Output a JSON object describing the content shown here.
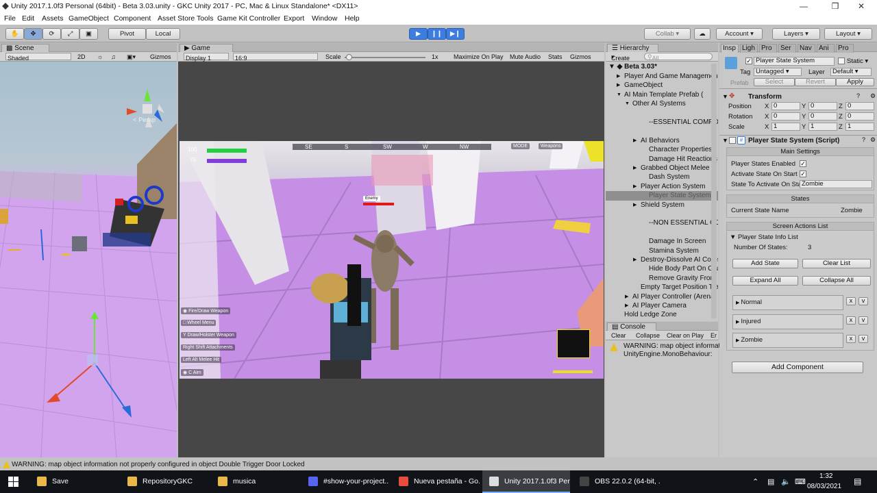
{
  "window": {
    "title": "Unity 2017.1.0f3 Personal (64bit) - Beta 3.03.unity - GKC Unity 2017 - PC, Mac & Linux Standalone* <DX11>"
  },
  "menu": [
    "File",
    "Edit",
    "Assets",
    "GameObject",
    "Component",
    "Asset Store Tools",
    "Game Kit Controller",
    "Export",
    "Window",
    "Help"
  ],
  "toolbar": {
    "pivot": "Pivot",
    "local": "Local",
    "collab": "Collab",
    "account": "Account",
    "layers": "Layers",
    "layout": "Layout"
  },
  "scene": {
    "tab": "Scene",
    "shading": "Shaded",
    "mode2d": "2D",
    "gizmos": "Gizmos",
    "persp": "< Persp",
    "search": "All"
  },
  "game": {
    "tab": "Game",
    "display": "Display 1",
    "aspect": "16:9",
    "scale_label": "Scale",
    "scale_value": "1x",
    "maximize": "Maximize On Play",
    "mute": "Mute Audio",
    "stats": "Stats",
    "gizmos": "Gizmos"
  },
  "hud": {
    "health": "100",
    "stamina": "75",
    "compass": [
      "SE",
      "S",
      "SW",
      "W",
      "NW"
    ],
    "mode": "MODE",
    "weapons": "Weapons",
    "enemy": "Enemy",
    "hints": [
      {
        "key": "",
        "label": "Fire/Draw Weapon"
      },
      {
        "key": "",
        "label": "Wheel Menu"
      },
      {
        "key": "Y",
        "label": "Draw/Holster Weapon"
      },
      {
        "key": "Right Shift",
        "label": "Attachments"
      },
      {
        "key": "Left Alt",
        "label": "Melee Hit"
      },
      {
        "key": "C",
        "label": "Aim"
      }
    ]
  },
  "hierarchy": {
    "tab": "Hierarchy",
    "create": "Create",
    "search": "All",
    "scene": "Beta 3.03*",
    "items": [
      {
        "label": "Player And Game Management",
        "indent": 1,
        "arrow": "▶"
      },
      {
        "label": "GameObject",
        "indent": 1,
        "arrow": "▶"
      },
      {
        "label": "AI Main Template Prefab (",
        "indent": 1,
        "arrow": "▼"
      },
      {
        "label": "Other AI Systems",
        "indent": 2,
        "arrow": "▼"
      },
      {
        "label": "",
        "indent": 3,
        "arrow": ""
      },
      {
        "label": "--ESSENTIAL COMPONENTS",
        "indent": 4,
        "arrow": ""
      },
      {
        "label": "",
        "indent": 3,
        "arrow": ""
      },
      {
        "label": "AI Behaviors",
        "indent": 3,
        "arrow": "▶"
      },
      {
        "label": "Character Properties",
        "indent": 4,
        "arrow": ""
      },
      {
        "label": "Damage Hit Reactions",
        "indent": 4,
        "arrow": ""
      },
      {
        "label": "Grabbed Object Melee",
        "indent": 3,
        "arrow": "▶"
      },
      {
        "label": "Dash System",
        "indent": 4,
        "arrow": ""
      },
      {
        "label": "Player Action System",
        "indent": 3,
        "arrow": "▶"
      },
      {
        "label": "Player State System",
        "indent": 4,
        "arrow": "",
        "selected": true
      },
      {
        "label": "Shield System",
        "indent": 3,
        "arrow": "▶"
      },
      {
        "label": "",
        "indent": 3,
        "arrow": ""
      },
      {
        "label": "--NON ESSENTIAL COMPONENTS",
        "indent": 4,
        "arrow": ""
      },
      {
        "label": "",
        "indent": 3,
        "arrow": ""
      },
      {
        "label": "Damage In Screen",
        "indent": 4,
        "arrow": ""
      },
      {
        "label": "Stamina System",
        "indent": 4,
        "arrow": ""
      },
      {
        "label": "Destroy-Dissolve AI Corpse",
        "indent": 3,
        "arrow": "▶"
      },
      {
        "label": "Hide Body Part On Character",
        "indent": 4,
        "arrow": ""
      },
      {
        "label": "Remove Gravity From Character",
        "indent": 4,
        "arrow": ""
      },
      {
        "label": "Empty Target Position Transform",
        "indent": 3,
        "arrow": ""
      },
      {
        "label": "AI Player Controller (Arena)",
        "indent": 2,
        "arrow": "▶"
      },
      {
        "label": "AI Player Camera",
        "indent": 2,
        "arrow": "▶"
      },
      {
        "label": "Hold Ledge Zone",
        "indent": 1,
        "arrow": ""
      }
    ]
  },
  "console": {
    "tab": "Console",
    "clear": "Clear",
    "collapse": "Collapse",
    "clearplay": "Clear on Play",
    "err": "Er",
    "msg1": "WARNING: map object information",
    "msg2": "UnityEngine.MonoBehaviour:"
  },
  "inspector": {
    "tabs": [
      "Insp",
      "Ligh",
      "Pro",
      "Ser",
      "Nav",
      "Ani",
      "Pro"
    ],
    "object_name": "Player State System",
    "static": "Static",
    "tag_label": "Tag",
    "tag": "Untagged",
    "layer_label": "Layer",
    "layer": "Default",
    "prefab": "Prefab",
    "select": "Select",
    "revert": "Revert",
    "apply": "Apply",
    "transform": {
      "title": "Transform",
      "rows": [
        {
          "label": "Position",
          "x": "0",
          "y": "0",
          "z": "0"
        },
        {
          "label": "Rotation",
          "x": "0",
          "y": "0",
          "z": "0"
        },
        {
          "label": "Scale",
          "x": "1",
          "y": "1",
          "z": "1"
        }
      ]
    },
    "script": {
      "title": "Player State System (Script)",
      "main_settings": "Main Settings",
      "f1": "Player States Enabled",
      "f2": "Activate State On Start",
      "f3": "State To Activate On Start",
      "f3_value": "Zombie",
      "states": "States",
      "current_label": "Current State Name",
      "current_value": "Zombie",
      "screen_actions": "Screen Actions List",
      "info_list": "Player State Info List",
      "num_label": "Number Of States:",
      "num_value": "3",
      "add_state": "Add State",
      "clear_list": "Clear List",
      "expand_all": "Expand All",
      "collapse_all": "Collapse All",
      "states_list": [
        "Normal",
        "Injured",
        "Zombie"
      ]
    },
    "add_component": "Add Component"
  },
  "status": {
    "message": "WARNING: map object information not properly configured in object Double Trigger Door Locked"
  },
  "taskbar": {
    "items": [
      {
        "label": "Save",
        "color": "#e8b84a"
      },
      {
        "label": "RepositoryGKC",
        "color": "#e8b84a"
      },
      {
        "label": "musica",
        "color": "#e8b84a"
      },
      {
        "label": "#show-your-project...",
        "color": "#5865f2"
      },
      {
        "label": "Nueva pestaña - Go...",
        "color": "#e74c3c"
      },
      {
        "label": "Unity 2017.1.0f3 Per...",
        "color": "#dddddd"
      },
      {
        "label": "OBS 22.0.2 (64-bit, ...",
        "color": "#444444"
      }
    ],
    "time": "1:32",
    "date": "08/03/2021"
  }
}
